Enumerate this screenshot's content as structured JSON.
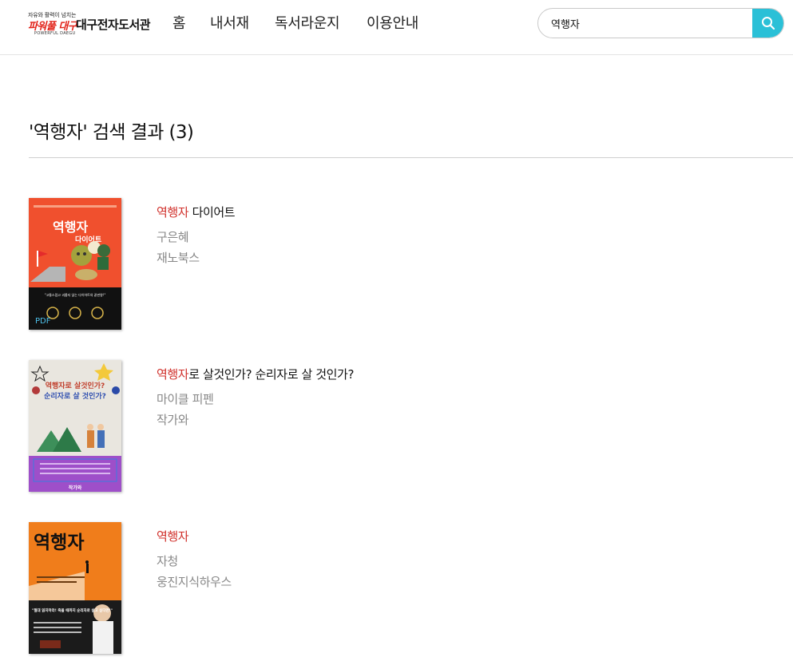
{
  "header": {
    "logo": {
      "slogan": "자유와 활력이 넘치는",
      "brand": "파워풀 대구",
      "brand_sub": "POWERFUL DAEGU",
      "library_name": "대구전자도서관"
    },
    "nav": [
      "홈",
      "내서재",
      "독서라운지",
      "이용안내"
    ],
    "search": {
      "value": "역행자",
      "icon": "search-icon"
    }
  },
  "results": {
    "title": "'역행자' 검색 결과 (3)",
    "books": [
      {
        "title_highlight": "역행자",
        "title_rest": " 다이어트",
        "author": "구은혜",
        "publisher": "재노북스",
        "cover": {
          "title": "역행자",
          "subtitle": "다이어트",
          "tagline": "\"고통스럽고 괴롭지 않는 다이어트의 끝판왕!\"",
          "badge": "PDF"
        }
      },
      {
        "title_highlight": "역행자",
        "title_rest": "로 살것인가? 순리자로 살 것인가?",
        "author": "마이클 피펜",
        "publisher": "작가와",
        "cover": {
          "line1": "역행자로 살것인가?",
          "line2": "순리자로 살 것인가?",
          "publisher_mark": "작가와"
        }
      },
      {
        "title_highlight": "역행자",
        "title_rest": "",
        "author": "자청",
        "publisher": "웅진지식하우스",
        "cover": {
          "title": "역행자",
          "quote": "\"절대 읽지마라! 죽을 때까지 순리자로 살고 싶다면!\""
        }
      }
    ]
  },
  "colors": {
    "accent": "#2ac0d7",
    "highlight": "#d0302b",
    "meta_text": "#888888",
    "brand_red": "#e2231a"
  }
}
